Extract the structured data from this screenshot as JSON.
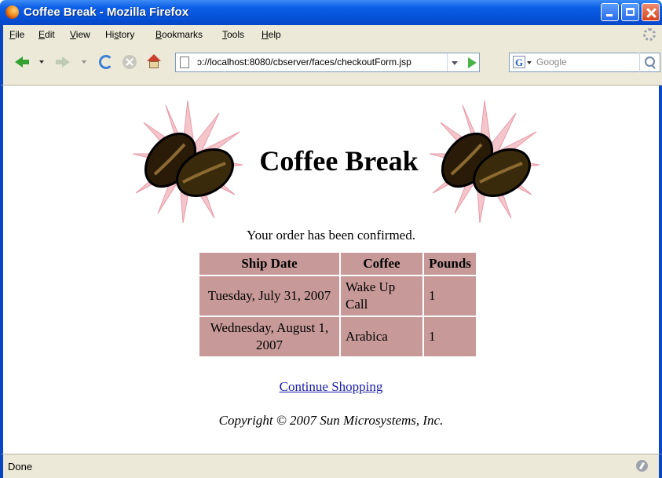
{
  "window": {
    "title": "Coffee Break - Mozilla Firefox"
  },
  "menu": [
    {
      "label": "File",
      "accel": "F",
      "rest": "ile"
    },
    {
      "label": "Edit",
      "accel": "E",
      "rest": "dit"
    },
    {
      "label": "View",
      "accel": "V",
      "rest": "iew"
    },
    {
      "label": "History",
      "pre": "Hi",
      "accel": "s",
      "rest": "tory"
    },
    {
      "label": "Bookmarks",
      "accel": "B",
      "rest": "ookmarks"
    },
    {
      "label": "Tools",
      "accel": "T",
      "rest": "ools"
    },
    {
      "label": "Help",
      "accel": "H",
      "rest": "elp"
    }
  ],
  "navbar": {
    "url": "ɔ://localhost:8080/cbserver/faces/checkoutForm.jsp",
    "search_placeholder": "Google"
  },
  "page": {
    "banner_title": "Coffee Break",
    "confirmation": "Your order has been confirmed.",
    "table": {
      "headers": [
        "Ship Date",
        "Coffee",
        "Pounds"
      ],
      "rows": [
        [
          "Tuesday, July 31, 2007",
          "Wake Up Call",
          "1"
        ],
        [
          "Wednesday, August 1, 2007",
          "Arabica",
          "1"
        ]
      ]
    },
    "continue_link": "Continue Shopping",
    "copyright": "Copyright © 2007 Sun Microsystems, Inc."
  },
  "status": {
    "text": "Done"
  },
  "colors": {
    "titlebar": "#0551d8",
    "table_cell": "#c79a99",
    "link": "#1a1aa6"
  }
}
